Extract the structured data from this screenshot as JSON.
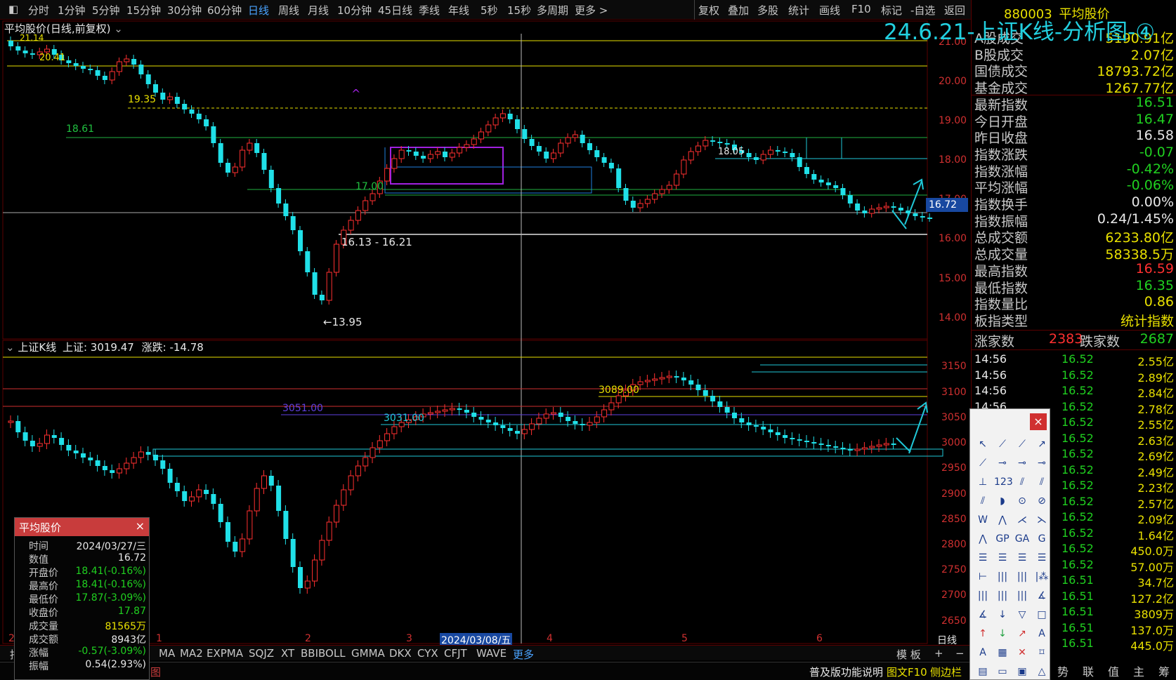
{
  "toolbar": {
    "periods": [
      "分时",
      "1分钟",
      "5分钟",
      "15分钟",
      "30分钟",
      "60分钟",
      "日线",
      "周线",
      "月线",
      "10分钟",
      "45日线",
      "季线",
      "年线",
      "5秒",
      "15秒",
      "多周期",
      "更多 >"
    ],
    "active_period": "日线",
    "actions": [
      "复权",
      "叠加",
      "多股",
      "统计",
      "画线",
      "F10",
      "标记",
      "-自选",
      "返回"
    ]
  },
  "upper_chart": {
    "title": "平均股价(日线,前复权)",
    "y_ticks": [
      "21.00",
      "20.00",
      "19.00",
      "18.00",
      "17.00",
      "16.00",
      "15.00",
      "14.00"
    ],
    "current_price_tag": "16.72",
    "annotations": {
      "top_left_high": "20.41",
      "level_1935": "19.35",
      "level_1861": "18.61",
      "level_1700": "17.00",
      "level_1805": "18.05",
      "range_label": "16.13 - 16.21",
      "low_label": "←13.95",
      "top_left_cut": "21.14"
    }
  },
  "lower_chart": {
    "title_name": "上证K线",
    "title_index": "上证: 3019.47",
    "title_change": "涨跌: -14.78",
    "y_ticks": [
      "3150",
      "3100",
      "3050",
      "3000",
      "2950",
      "2900",
      "2850",
      "2800",
      "2750",
      "2700",
      "2650"
    ],
    "annotations": {
      "level_3089": "3089.00",
      "level_3051": "3051.00",
      "level_3031": "3031.00"
    },
    "month_labels": [
      "1",
      "2",
      "3",
      "4",
      "5",
      "6"
    ],
    "cursor_date": "2024/03/08/五",
    "period_label": "日线"
  },
  "overlay_title": "24.6.21-上证K线-分析图-④",
  "right_panel": {
    "code": "880003",
    "name": "平均股价",
    "rows": [
      {
        "label": "A股成交",
        "value": "5190.91亿",
        "color": "#e8e000"
      },
      {
        "label": "B股成交",
        "value": "2.07亿",
        "color": "#e8e000"
      },
      {
        "label": "国债成交",
        "value": "18793.72亿",
        "color": "#e8e000"
      },
      {
        "label": "基金成交",
        "value": "1267.77亿",
        "color": "#e8e000"
      },
      {
        "label": "最新指数",
        "value": "16.51",
        "color": "#20d020"
      },
      {
        "label": "今日开盘",
        "value": "16.47",
        "color": "#20d020"
      },
      {
        "label": "昨日收盘",
        "value": "16.58",
        "color": "#e8e8e8"
      },
      {
        "label": "指数涨跌",
        "value": "-0.07",
        "color": "#20d020"
      },
      {
        "label": "指数涨幅",
        "value": "-0.42%",
        "color": "#20d020"
      },
      {
        "label": "平均涨幅",
        "value": "-0.06%",
        "color": "#20d020"
      },
      {
        "label": "指数换手",
        "value": "0.00%",
        "color": "#e8e8e8"
      },
      {
        "label": "指数振幅",
        "value": "0.24/1.45%",
        "color": "#e8e8e8"
      },
      {
        "label": "总成交额",
        "value": "6233.80亿",
        "color": "#e8e000"
      },
      {
        "label": "总成交量",
        "value": "58338.5万",
        "color": "#e8e000"
      },
      {
        "label": "最高指数",
        "value": "16.59",
        "color": "#ff3030"
      },
      {
        "label": "最低指数",
        "value": "16.35",
        "color": "#20d020"
      },
      {
        "label": "指数量比",
        "value": "0.86",
        "color": "#e8e000"
      },
      {
        "label": "板指类型",
        "value": "统计指数",
        "color": "#e8e000"
      }
    ],
    "rise_label": "涨家数",
    "rise_value": "2383",
    "fall_label": "跌家数",
    "fall_value": "2687",
    "ticks": [
      {
        "time": "14:56",
        "price": "16.52",
        "amount": "2.55亿"
      },
      {
        "time": "14:56",
        "price": "16.52",
        "amount": "2.89亿"
      },
      {
        "time": "14:56",
        "price": "16.52",
        "amount": "2.84亿"
      },
      {
        "time": "14:56",
        "price": "16.52",
        "amount": "2.78亿"
      },
      {
        "time": "",
        "price": "16.52",
        "amount": "2.55亿"
      },
      {
        "time": "",
        "price": "16.52",
        "amount": "2.63亿"
      },
      {
        "time": "",
        "price": "16.52",
        "amount": "2.69亿"
      },
      {
        "time": "",
        "price": "16.52",
        "amount": "2.49亿"
      },
      {
        "time": "",
        "price": "16.52",
        "amount": "2.23亿"
      },
      {
        "time": "",
        "price": "16.52",
        "amount": "2.57亿"
      },
      {
        "time": "",
        "price": "16.52",
        "amount": "2.09亿"
      },
      {
        "time": "",
        "price": "16.52",
        "amount": "1.64亿"
      },
      {
        "time": "",
        "price": "16.52",
        "amount": "450.0万"
      },
      {
        "time": "",
        "price": "16.52",
        "amount": "57.00万"
      },
      {
        "time": "",
        "price": "16.51",
        "amount": "34.7亿"
      },
      {
        "time": "",
        "price": "16.51",
        "amount": "127.2亿"
      },
      {
        "time": "",
        "price": "16.51",
        "amount": "3809万"
      },
      {
        "time": "",
        "price": "16.51",
        "amount": "137.0万"
      },
      {
        "time": "",
        "price": "16.51",
        "amount": "445.0万"
      }
    ],
    "bottom_tabs": [
      "势",
      "联",
      "值",
      "主",
      "筹"
    ]
  },
  "popup": {
    "title": "平均股价",
    "rows": [
      {
        "label": "时间",
        "value": "2024/03/27/三",
        "color": "#e8e8e8"
      },
      {
        "label": "数值",
        "value": "16.72",
        "color": "#e8e8e8"
      },
      {
        "label": "开盘价",
        "value": "18.41(-0.16%)",
        "color": "#20d020"
      },
      {
        "label": "最高价",
        "value": "18.41(-0.16%)",
        "color": "#20d020"
      },
      {
        "label": "最低价",
        "value": "17.87(-3.09%)",
        "color": "#20d020"
      },
      {
        "label": "收盘价",
        "value": "17.87",
        "color": "#20d020"
      },
      {
        "label": "成交量",
        "value": "81565万",
        "color": "#e8e000"
      },
      {
        "label": "成交额",
        "value": "8943亿",
        "color": "#e8e8e8"
      },
      {
        "label": "涨幅",
        "value": "-0.57(-3.09%)",
        "color": "#20d020"
      },
      {
        "label": "振幅",
        "value": "0.54(2.93%)",
        "color": "#e8e8e8"
      }
    ]
  },
  "bottom_bar": {
    "indicators": [
      "MA",
      "MA2",
      "EXPMA",
      "SQJZ",
      "XT",
      "BBIBOLL",
      "GMMA",
      "DKX",
      "CYX",
      "CFJT",
      "WAVE",
      "更多"
    ],
    "template_label": "模 板",
    "plus": "+",
    "minus": "−"
  },
  "status_bar": {
    "left_cut": "图",
    "help": "普及版功能说明",
    "f10": "图文F10",
    "side": "侧边栏"
  },
  "draw_tools": {
    "close": "×",
    "labels": [
      "123",
      "GP",
      "GA",
      "G",
      "A",
      "A"
    ]
  }
}
